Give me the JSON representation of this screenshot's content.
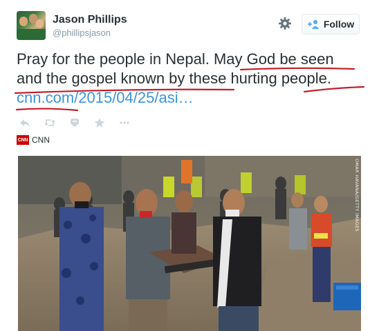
{
  "user": {
    "name": "Jason Phillips",
    "handle": "@phillipsjason",
    "follow_label": "Follow",
    "avatar_icon": "profile-photo",
    "settings_icon": "gear-icon"
  },
  "tweet": {
    "text": "Pray for the people in Nepal. May God be seen and the gospel known by these hurting people.",
    "link": "cnn.com/2015/04/25/asi…"
  },
  "actions": [
    {
      "name": "reply-icon"
    },
    {
      "name": "retweet-icon"
    },
    {
      "name": "favorite-icon"
    },
    {
      "name": "star-icon"
    },
    {
      "name": "more-icon"
    }
  ],
  "card": {
    "source_name": "CNN",
    "logo_text": "CNN",
    "photo_credit": "OMAR HAVANA/GETTY IMAGES"
  },
  "colors": {
    "link": "#3b94d9",
    "underline": "#c21e2b",
    "follow_icon": "#55acee",
    "cnn_red": "#cc0000"
  }
}
